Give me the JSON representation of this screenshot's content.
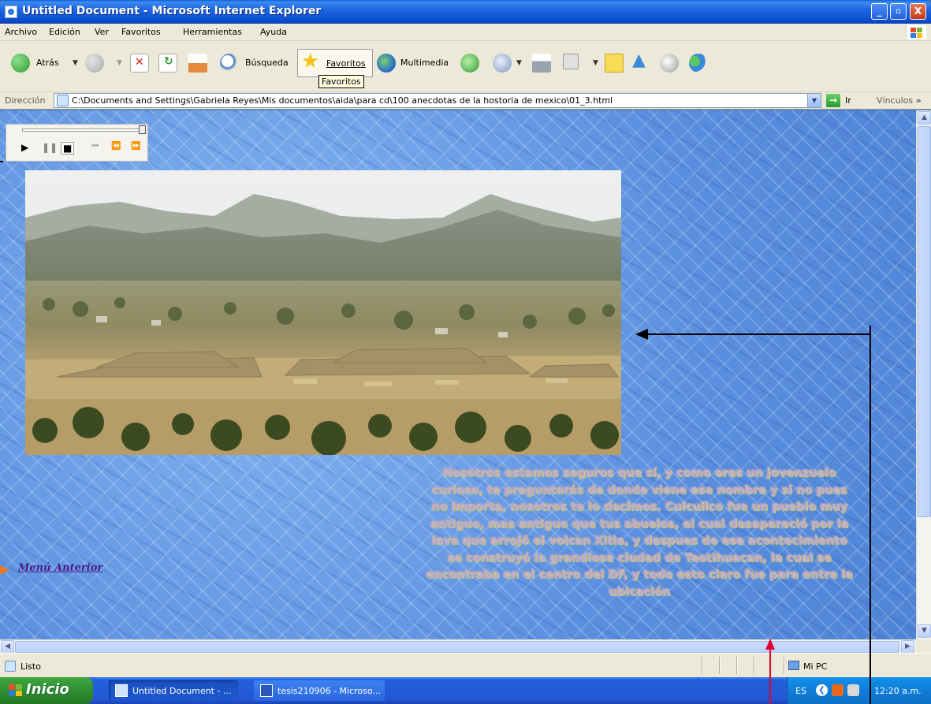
{
  "window": {
    "title": "Untitled Document - Microsoft Internet Explorer",
    "controls": {
      "minimize": "_",
      "maximize": "▫",
      "close": "X"
    }
  },
  "menubar": {
    "items": [
      "Archivo",
      "Edición",
      "Ver",
      "Favoritos",
      "Herramientas",
      "Ayuda"
    ]
  },
  "toolbar": {
    "back_label": "Atrás",
    "search_label": "Búsqueda",
    "favorites_label": "Favoritos",
    "multimedia_label": "Multimedia",
    "favorites_tooltip": "Favoritos"
  },
  "address": {
    "label": "Dirección",
    "url": "C:\\Documents and Settings\\Gabriela Reyes\\Mis documentos\\aida\\para cd\\100 anecdotas de la hostoria de mexico\\01_3.html",
    "go_label": "Ir",
    "links_label": "Vínculos",
    "links_more": "»"
  },
  "page": {
    "menu_anterior": "Menú Anterior",
    "story_text": "Nosotros estamos seguros que sí, y como eres un jovenzuelo curioso, te preguntarás de donde viene ese nombre y si no pues no importa, nosotros te lo decimos. Cuicuilco fue un pueblo muy antiguo, mas antiguo que tus abuelos, el cual desapareció por la lava que arrojó el volcan Xitle, y despues de ese acontecimiento se construyó la grandiosa ciudad de Teotihuacan, la cual se encontraba en el centro del DF, y todo esto claro fue para entre la ubicación"
  },
  "statusbar": {
    "status_text": "Listo",
    "zone_text": "Mi PC"
  },
  "taskbar": {
    "start_label": "Inicio",
    "tasks": [
      {
        "label": "Untitled Document - ..."
      },
      {
        "label": "tesis210906 - Microso..."
      }
    ],
    "language": "ES",
    "clock": "12:20 a.m."
  },
  "colors": {
    "titlebar_blue": "#0b4fd0",
    "page_background": "#6b9fe6",
    "link_purple": "#4b1f8a",
    "story_text": "#b9a7dd",
    "annotation_black": "#000000",
    "annotation_red": "#e0002a"
  }
}
